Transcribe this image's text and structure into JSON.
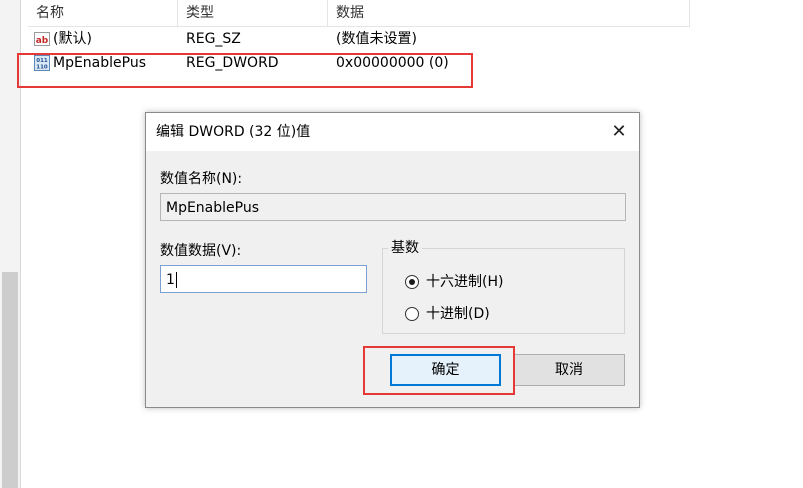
{
  "columns": {
    "name": "名称",
    "type": "类型",
    "data": "数据"
  },
  "rows": [
    {
      "icon": "string-value-icon",
      "icon_text": "ab",
      "name": "(默认)",
      "type": "REG_SZ",
      "data": "(数值未设置)"
    },
    {
      "icon": "binary-value-icon",
      "icon_text": "011 110",
      "name": "MpEnablePus",
      "type": "REG_DWORD",
      "data": "0x00000000 (0)"
    }
  ],
  "dialog": {
    "title": "编辑 DWORD (32 位)值",
    "close_glyph": "✕",
    "value_name_label": "数值名称(N):",
    "value_name": "MpEnablePus",
    "value_data_label": "数值数据(V):",
    "value_data": "1",
    "base_group_label": "基数",
    "base_options": [
      {
        "label": "十六进制(H)",
        "selected": true
      },
      {
        "label": "十进制(D)",
        "selected": false
      }
    ],
    "ok_label": "确定",
    "cancel_label": "取消"
  },
  "colors": {
    "highlight": "#e53935",
    "accent": "#0078d7"
  }
}
